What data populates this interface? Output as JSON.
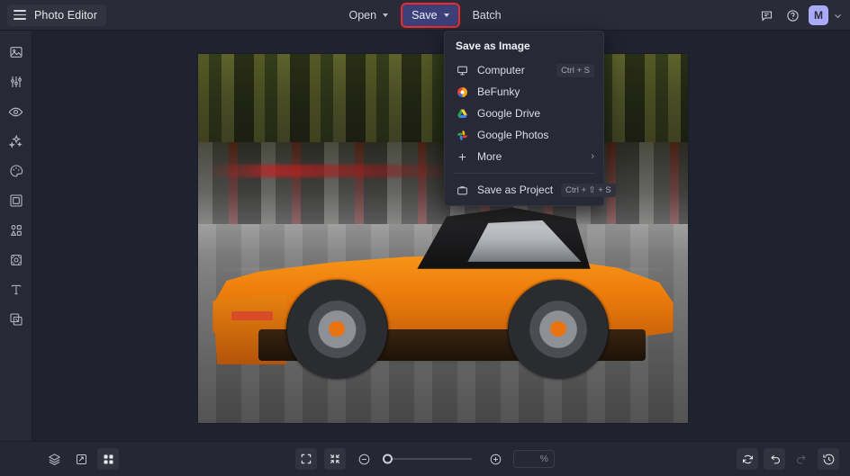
{
  "app": {
    "brand_label": "Photo Editor",
    "burger_icon": "hamburger-menu-icon"
  },
  "topbar": {
    "menus": [
      {
        "label": "Open",
        "has_caret": true,
        "active": false,
        "highlighted": false
      },
      {
        "label": "Save",
        "has_caret": true,
        "active": true,
        "highlighted": true
      },
      {
        "label": "Batch",
        "has_caret": false,
        "active": false,
        "highlighted": false
      }
    ],
    "right_icons": [
      {
        "name": "feedback-chat-icon"
      },
      {
        "name": "help-question-icon"
      }
    ],
    "avatar_initial": "M",
    "avatar_color": "#a9abf7",
    "highlight_color": "#ef2a2a",
    "active_color": "#3b4078"
  },
  "sidebar": {
    "items": [
      {
        "name": "sidebar-item-edit",
        "icon": "image-edit-icon"
      },
      {
        "name": "sidebar-item-adjust",
        "icon": "sliders-icon"
      },
      {
        "name": "sidebar-item-retouch",
        "icon": "eye-icon"
      },
      {
        "name": "sidebar-item-effects",
        "icon": "sparkles-icon"
      },
      {
        "name": "sidebar-item-artsy",
        "icon": "palette-icon"
      },
      {
        "name": "sidebar-item-frames",
        "icon": "frame-icon"
      },
      {
        "name": "sidebar-item-overlays",
        "icon": "shapes-grid-icon"
      },
      {
        "name": "sidebar-item-textures",
        "icon": "texture-icon"
      },
      {
        "name": "sidebar-item-text",
        "icon": "text-t-icon"
      },
      {
        "name": "sidebar-item-graphics",
        "icon": "graphics-layers-icon"
      }
    ]
  },
  "canvas": {
    "photo_alt": "orange-sports-car-motion-blur-photo"
  },
  "dropdown": {
    "title": "Save as Image",
    "items": [
      {
        "label": "Computer",
        "icon": "monitor-icon",
        "shortcut": "Ctrl + S",
        "submenu": false
      },
      {
        "label": "BeFunky",
        "icon": "befunky-logo-icon",
        "shortcut": "",
        "submenu": false
      },
      {
        "label": "Google Drive",
        "icon": "google-drive-icon",
        "shortcut": "",
        "submenu": false
      },
      {
        "label": "Google Photos",
        "icon": "google-photos-icon",
        "shortcut": "",
        "submenu": false
      },
      {
        "label": "More",
        "icon": "plus-icon",
        "shortcut": "",
        "submenu": true
      }
    ],
    "project_item": {
      "label": "Save as Project",
      "icon": "briefcase-icon",
      "shortcut": "Ctrl + ⇧ + S"
    },
    "submenu_arrow": "›"
  },
  "bottombar": {
    "left_icons": [
      {
        "name": "layers-icon",
        "active": false
      },
      {
        "name": "compare-flip-icon",
        "active": false
      },
      {
        "name": "grid-view-icon",
        "active": true
      }
    ],
    "center": {
      "fullscreen_icon": "fullscreen-expand-icon",
      "fit_icon": "fit-to-screen-icon",
      "zoom_out_icon": "zoom-out-minus-icon",
      "zoom_in_icon": "zoom-in-plus-icon",
      "zoom_value": "",
      "zoom_unit": "%",
      "slider_position_pct": 0
    },
    "right_icons": [
      {
        "name": "reset-rotate-icon",
        "active": false,
        "disabled": false
      },
      {
        "name": "undo-icon",
        "active": false,
        "disabled": false
      },
      {
        "name": "redo-icon",
        "active": false,
        "disabled": true
      },
      {
        "name": "history-clock-icon",
        "active": false,
        "disabled": false
      }
    ]
  }
}
